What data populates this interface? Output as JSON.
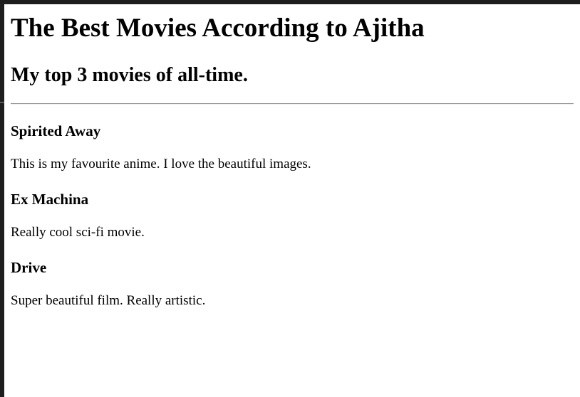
{
  "page": {
    "title": "The Best Movies According to Ajitha",
    "subtitle": "My top 3 movies of all-time."
  },
  "movies": [
    {
      "title": "Spirited Away",
      "description": "This is my favourite anime. I love the beautiful images."
    },
    {
      "title": "Ex Machina",
      "description": "Really cool sci-fi movie."
    },
    {
      "title": "Drive",
      "description": "Super beautiful film. Really artistic."
    }
  ],
  "colors": {
    "background": "#ffffff",
    "text": "#000000",
    "window_frame": "#1e1e1e",
    "divider": "#9a9a9a"
  }
}
